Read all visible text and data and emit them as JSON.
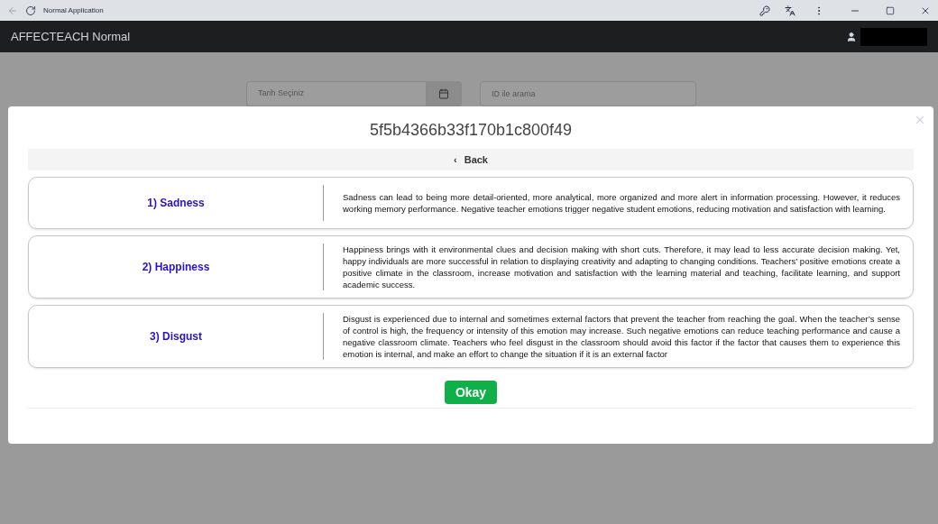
{
  "window": {
    "title": "Normal Application"
  },
  "app_header": {
    "title": "AFFECTEACH Normal"
  },
  "filters": {
    "date": {
      "placeholder": "Tarih Seçiniz"
    },
    "id_search": {
      "placeholder": "ID ile arama"
    }
  },
  "modal": {
    "title": "5f5b4366b33f170b1c800f49",
    "back": {
      "icon": "‹",
      "label": "Back"
    },
    "emotions": [
      {
        "label": "1) Sadness",
        "description": "Sadness can lead to being more detail-oriented, more analytical, more organized and more alert in information processing. However, it reduces working memory performance. Negative teacher emotions trigger negative student emotions, reducing motivation and satisfaction with learning."
      },
      {
        "label": "2) Happiness",
        "description": "Happiness brings with it environmental clues and decision making with short cuts. Therefore, it may lead to less accurate decision making. Yet, happy individuals are more successful in relation to displaying creativity and adapting to changing conditions. Teachers’ positive emotions create a positive climate in the classroom, increase motivation and satisfaction with the learning material and teaching, facilitate learning, and support academic success."
      },
      {
        "label": "3) Disgust",
        "description": "Disgust is experienced due to internal and sometimes external factors that prevent the teacher from reaching the goal. When the teacher’s sense of control is high, the frequency or intensity of this emotion may increase. Such negative emotions can reduce teaching performance and cause a negative classroom climate. Teachers who feel disgust in the classroom should avoid this factor if the factor that causes them to experience this emotion is internal, and make an effort to change the situation if it is an external factor"
      }
    ],
    "ok_button": "Okay"
  }
}
